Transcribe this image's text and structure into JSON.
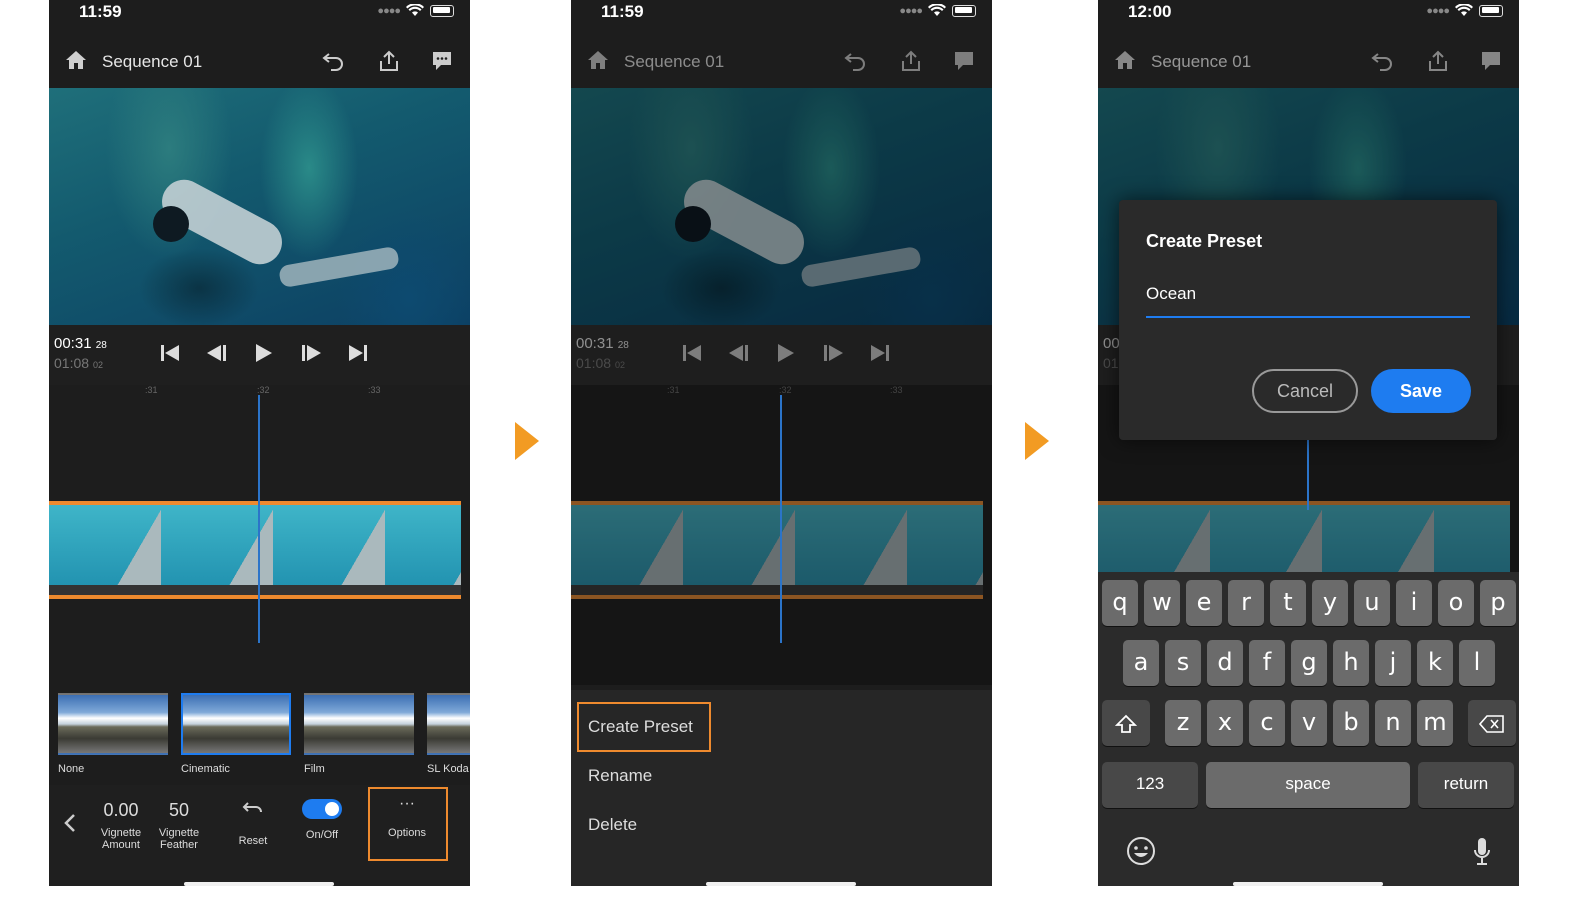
{
  "colors": {
    "accent_orange": "#ee8a2e",
    "accent_blue": "#1e7cf0",
    "arrow": "#f29b23",
    "bg_dark": "#1d1d1d"
  },
  "phones": [
    {
      "time": "11:59",
      "title": "Sequence 01",
      "timecode": {
        "main": "00:31",
        "main_frames": "28",
        "total": "01:08",
        "total_frames": "02"
      },
      "ruler": [
        ":31",
        ":32",
        ":33"
      ],
      "filters": [
        {
          "label": "None",
          "selected": false
        },
        {
          "label": "Cinematic",
          "selected": true
        },
        {
          "label": "Film",
          "selected": false
        },
        {
          "label": "SL Koda",
          "selected": false
        }
      ],
      "toolbar": {
        "vignette_amount": {
          "value": "0.00",
          "label1": "Vignette",
          "label2": "Amount"
        },
        "vignette_feather": {
          "value": "50",
          "label1": "Vignette",
          "label2": "Feather"
        },
        "reset_label": "Reset",
        "onoff_label": "On/Off",
        "options_label": "Options",
        "options_icon": "···"
      }
    },
    {
      "time": "11:59",
      "title": "Sequence 01",
      "timecode": {
        "main": "00:31",
        "main_frames": "28",
        "total": "01:08",
        "total_frames": "02"
      },
      "ruler": [
        ":31",
        ":32",
        ":33"
      ],
      "menu": [
        "Create Preset",
        "Rename",
        "Delete"
      ]
    },
    {
      "time": "12:00",
      "title": "Sequence 01",
      "timecode_fragments": [
        "00",
        "01"
      ],
      "dialog": {
        "title": "Create Preset",
        "input_value": "Ocean",
        "cancel": "Cancel",
        "save": "Save"
      },
      "keyboard": {
        "row1": [
          "q",
          "w",
          "e",
          "r",
          "t",
          "y",
          "u",
          "i",
          "o",
          "p"
        ],
        "row2": [
          "a",
          "s",
          "d",
          "f",
          "g",
          "h",
          "j",
          "k",
          "l"
        ],
        "row3": [
          "z",
          "x",
          "c",
          "v",
          "b",
          "n",
          "m"
        ],
        "numbers": "123",
        "space": "space",
        "return": "return"
      }
    }
  ]
}
